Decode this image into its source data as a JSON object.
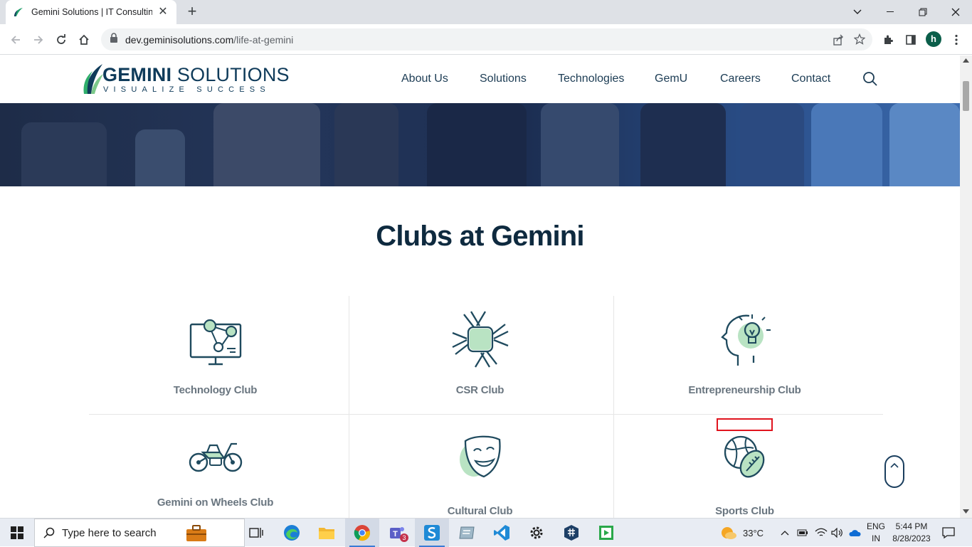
{
  "browser": {
    "tab_title": "Gemini Solutions | IT Consulting,",
    "url_host": "dev.geminisolutions.com",
    "url_path": "/life-at-gemini",
    "profile_initial": "h"
  },
  "site": {
    "logo": {
      "brand_bold": "GEMINI",
      "brand_regular": " SOLUTIONS",
      "tagline": "VISUALIZE SUCCESS"
    },
    "nav": [
      "About Us",
      "Solutions",
      "Technologies",
      "GemU",
      "Careers",
      "Contact"
    ],
    "section_title": "Clubs at Gemini",
    "clubs": [
      {
        "label": "Technology Club",
        "icon": "monitor-network-icon"
      },
      {
        "label": "CSR Club",
        "icon": "joined-hands-icon"
      },
      {
        "label": "Entrepreneurship Club",
        "icon": "head-lightbulb-icon"
      },
      {
        "label": "Gemini on Wheels Club",
        "icon": "motorcycle-icon"
      },
      {
        "label": "Cultural Club",
        "icon": "theatre-mask-icon"
      },
      {
        "label": "Sports Club",
        "icon": "sports-balls-icon"
      }
    ],
    "accent_color": "#0f3b5a",
    "green_color": "#7cc98a"
  },
  "taskbar": {
    "search_placeholder": "Type here to search",
    "teams_badge": "3",
    "weather": "33°C",
    "language": [
      "ENG",
      "IN"
    ],
    "time": "5:44 PM",
    "date": "8/28/2023"
  }
}
